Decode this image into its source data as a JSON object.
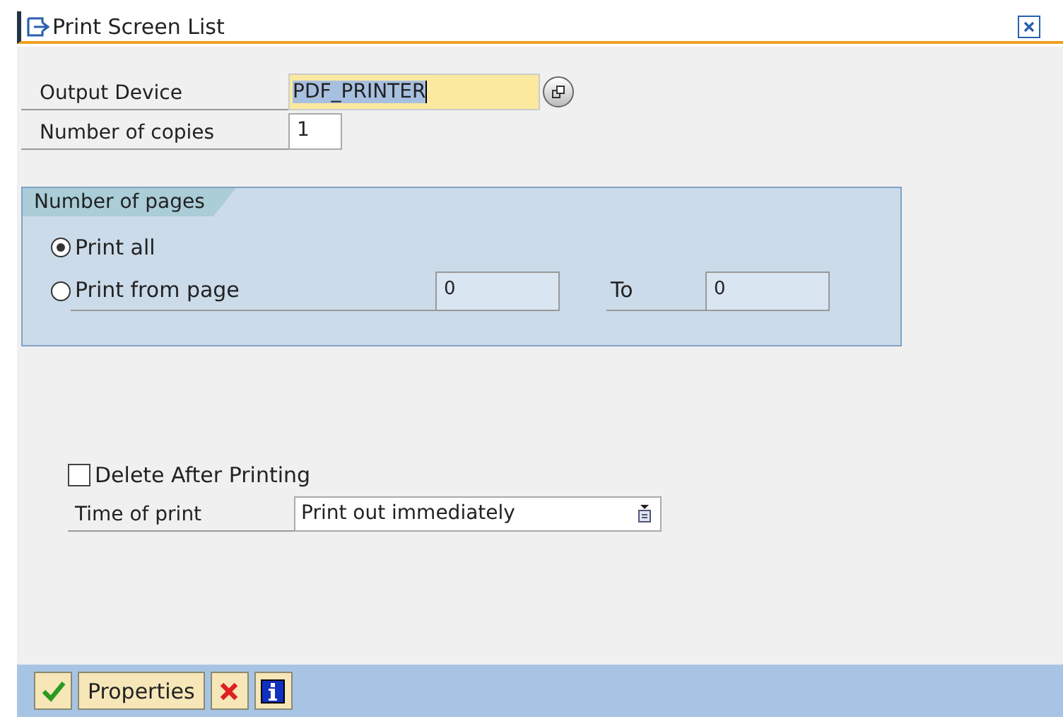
{
  "window": {
    "title": "Print Screen List"
  },
  "output_device": {
    "label": "Output Device",
    "value": "PDF_PRINTER"
  },
  "copies": {
    "label": "Number of copies",
    "value": "1"
  },
  "pages": {
    "title": "Number of pages",
    "options": [
      {
        "label": "Print all",
        "selected": true
      },
      {
        "label": "Print from page",
        "selected": false
      }
    ],
    "from_value": "0",
    "to_label": "To",
    "to_value": "0"
  },
  "delete_after": {
    "label": "Delete After Printing",
    "checked": false
  },
  "time_of_print": {
    "label": "Time of print",
    "value": "Print out immediately"
  },
  "buttons": [
    {
      "kind": "ok"
    },
    {
      "kind": "text",
      "label": "Properties"
    },
    {
      "kind": "cancel"
    },
    {
      "kind": "info"
    }
  ]
}
